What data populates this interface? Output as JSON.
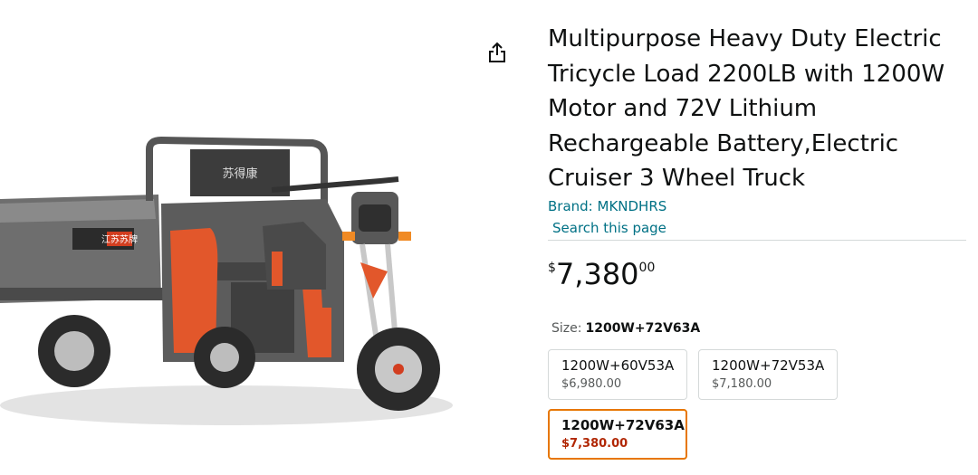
{
  "product": {
    "title": "Multipurpose Heavy Duty Electric Tricycle Load 2200LB with 1200W Motor and 72V Lithium Rechargeable Battery,Electric Cruiser 3 Wheel Truck",
    "brand": "Brand: MKNDHRS",
    "search_link": "Search this page",
    "image_label": "Electric cargo tricycle, grey with orange accents",
    "cab_text": "江苏苏牌",
    "seat_text": "苏得康"
  },
  "price": {
    "symbol": "$",
    "whole": "7,380",
    "fraction": "00"
  },
  "size": {
    "label": "Size:",
    "selected": "1200W+72V63A",
    "options": [
      {
        "label": "1200W+60V53A",
        "price": "$6,980.00"
      },
      {
        "label": "1200W+72V53A",
        "price": "$7,180.00"
      },
      {
        "label": "1200W+72V63A",
        "price": "$7,380.00"
      }
    ]
  },
  "icons": {
    "share": "share-icon"
  },
  "colors": {
    "link": "#007185",
    "selected_border": "#e77600",
    "selected_price": "#b12704",
    "accent_orange": "#e2572b"
  }
}
